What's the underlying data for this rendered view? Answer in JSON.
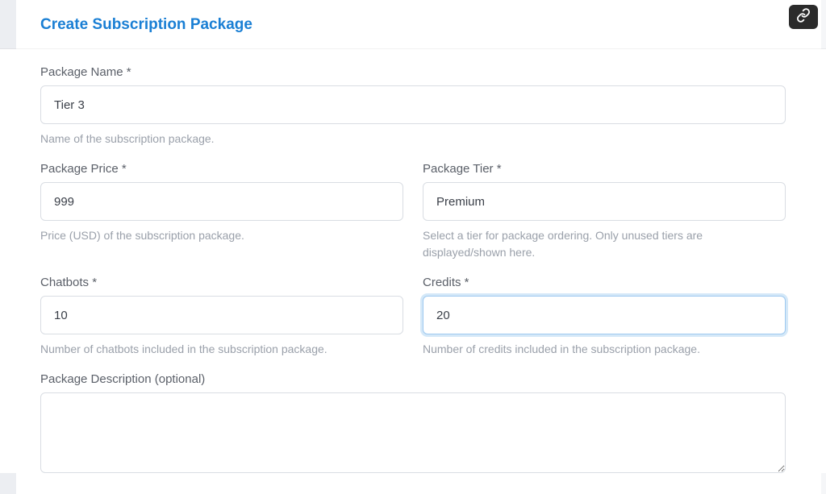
{
  "header": {
    "title": "Create Subscription Package"
  },
  "fields": {
    "packageName": {
      "label": "Package Name *",
      "value": "Tier 3",
      "help": "Name of the subscription package."
    },
    "packagePrice": {
      "label": "Package Price *",
      "value": "999",
      "help": "Price (USD) of the subscription package."
    },
    "packageTier": {
      "label": "Package Tier *",
      "value": "Premium",
      "help": "Select a tier for package ordering. Only unused tiers are displayed/shown here."
    },
    "chatbots": {
      "label": "Chatbots *",
      "value": "10",
      "help": "Number of chatbots included in the subscription package."
    },
    "credits": {
      "label": "Credits *",
      "value": "20",
      "help": "Number of credits included in the subscription package."
    },
    "description": {
      "label": "Package Description (optional)",
      "value": ""
    }
  }
}
